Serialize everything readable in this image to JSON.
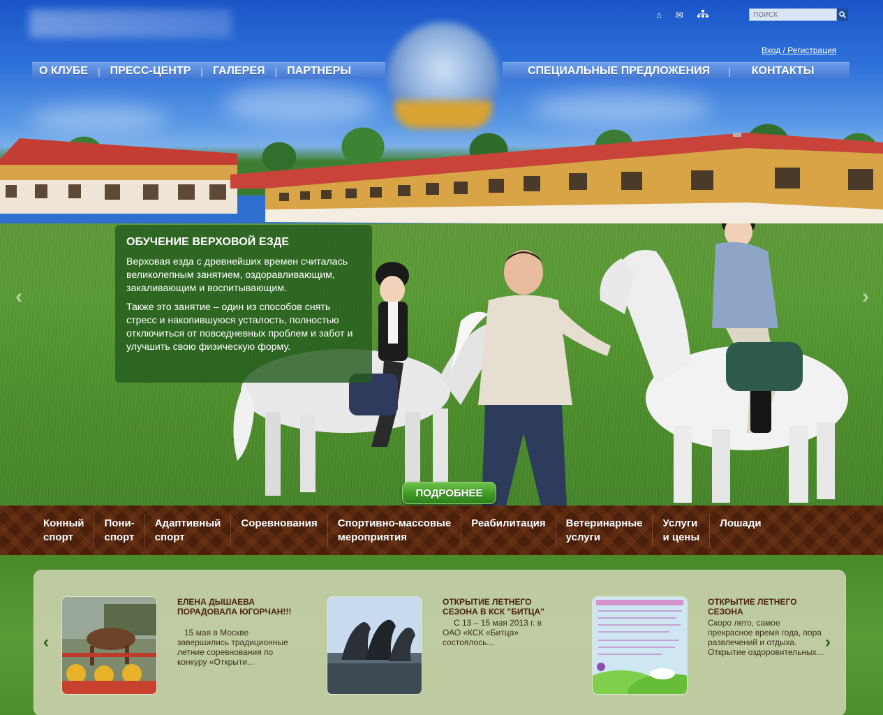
{
  "header": {
    "search_placeholder": "ПОИСК",
    "login_link": "Вход / Регистрация",
    "icons": [
      "home-icon",
      "mail-icon",
      "sitemap-icon",
      "search-icon"
    ]
  },
  "nav_left": [
    "О КЛУБЕ",
    "ПРЕСС-ЦЕНТР",
    "ГАЛЕРЕЯ",
    "ПАРТНЕРЫ"
  ],
  "nav_right": [
    "СПЕЦИАЛЬНЫЕ ПРЕДЛОЖЕНИЯ",
    "КОНТАКТЫ"
  ],
  "hero": {
    "title": "ОБУЧЕНИЕ ВЕРХОВОЙ ЕЗДЕ",
    "paragraph1": "Верховая езда с древнейших времен считалась великолепным занятием, оздоравливающим, закаливающим и воспитывающим.",
    "paragraph2": "Также это занятие – один из способов снять стресс и накопившуюся усталость, полностью отключиться от повседневных проблем и забот и улучшить свою физическую форму.",
    "more_button": "ПОДРОБНЕЕ"
  },
  "categories": [
    "Конный\nспорт",
    "Пони-\nспорт",
    "Адаптивный\nспорт",
    "Соревнования",
    "Спортивно-массовые\nмероприятия",
    "Реабилитация",
    "Ветеринарные\nуслуги",
    "Услуги\nи цены",
    "Лошади"
  ],
  "news": [
    {
      "title": "ЕЛЕНА ДЫШАЕВА ПОРАДОВАЛА ЮГОРЧАН!!!",
      "text": "15 мая в Москве завершились традиционные летние соревнования по конкуру «Открыти..."
    },
    {
      "title": "ОТКРЫТИЕ ЛЕТНЕГО СЕЗОНА В КСК \"БИТЦА\"",
      "text": "С 13 – 15 мая 2013 г. в ОАО «КСК «Битца» состоялось..."
    },
    {
      "title": "ОТКРЫТИЕ ЛЕТНЕГО СЕЗОНА",
      "text": "Скоро лето, самое прекрасное время года, пора развлечений и отдыха. Открытие оздоровительных..."
    }
  ],
  "colors": {
    "nav_blue": "#4678d2",
    "info_box_green": "#245c1e",
    "button_green": "#3e9a27",
    "category_band_brown": "#4a1f0c",
    "news_title_brown": "#4b2410"
  }
}
